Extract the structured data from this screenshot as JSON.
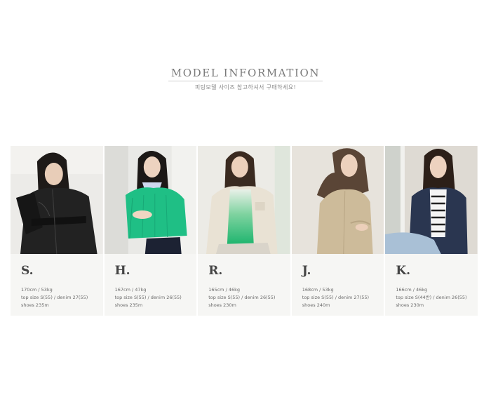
{
  "header": {
    "title": "MODEL INFORMATION",
    "subtitle": "피팅모델 사이즈 참고하셔서 구매하세요!"
  },
  "models": [
    {
      "initial": "S.",
      "height_weight": "170cm  /  53kg",
      "top_denim": "top size S(55)  /  denim  27(55)",
      "shoes": "shoes  235m",
      "outfit_color": "#2a2a2a"
    },
    {
      "initial": "H.",
      "height_weight": "167cm  /  47kg",
      "top_denim": "top size S(55)  /  denim  26(55)",
      "shoes": "shoes  235m",
      "outfit_color": "#1fbf85"
    },
    {
      "initial": "R.",
      "height_weight": "165cm  /  46kg",
      "top_denim": "top size S(55)  /  denim  26(55)",
      "shoes": "shoes  230m",
      "outfit_color": "#e9e2d4"
    },
    {
      "initial": "J.",
      "height_weight": "168cm  /  53kg",
      "top_denim": "top size S(55)  /  denim  27(55)",
      "shoes": "shoes  240m",
      "outfit_color": "#cdbb9a"
    },
    {
      "initial": "K.",
      "height_weight": "166cm  /  46kg",
      "top_denim": "top size S(44반)  /  denim  26(55)",
      "shoes": "shoes  230m",
      "outfit_color": "#2a3650"
    }
  ]
}
